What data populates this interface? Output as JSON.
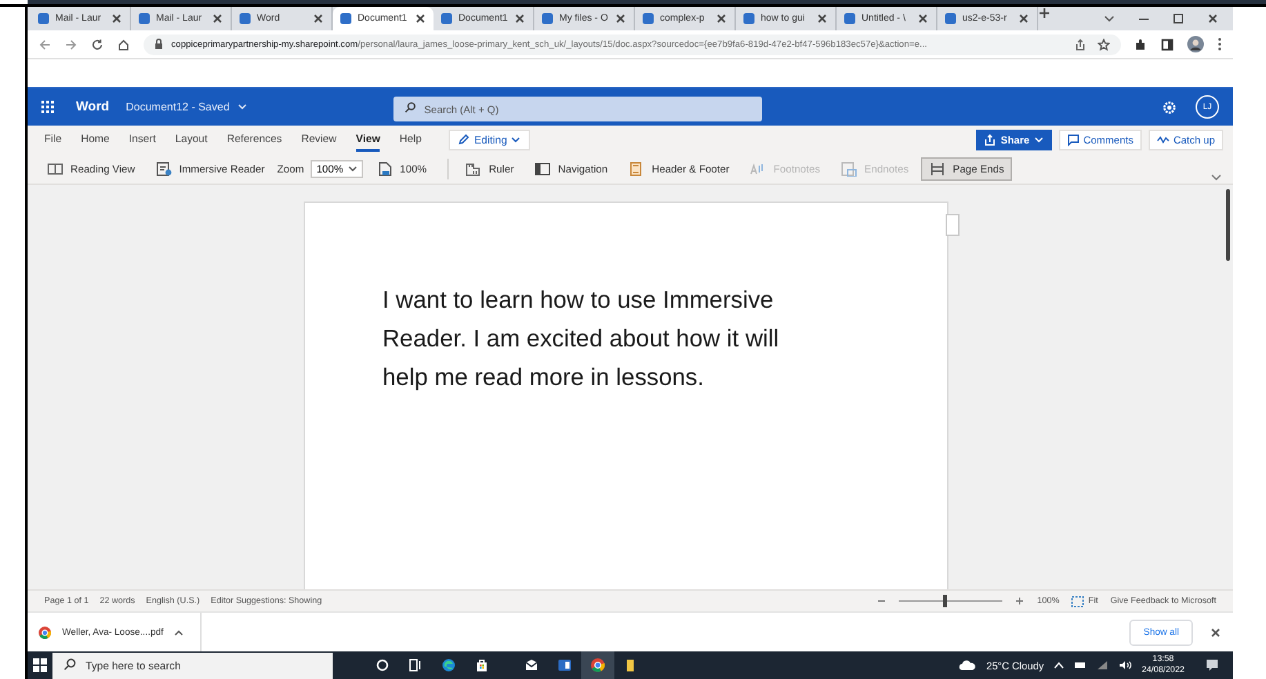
{
  "browser": {
    "tabs": [
      {
        "label": "Mail - Laur",
        "selected": false
      },
      {
        "label": "Mail - Laur",
        "selected": false
      },
      {
        "label": "Word",
        "selected": false
      },
      {
        "label": "Document1",
        "selected": true
      },
      {
        "label": "Document1",
        "selected": false
      },
      {
        "label": "My files - O",
        "selected": false
      },
      {
        "label": "complex-p",
        "selected": false
      },
      {
        "label": "how to gui",
        "selected": false
      },
      {
        "label": "Untitled - \\",
        "selected": false
      },
      {
        "label": "us2-e-53-r",
        "selected": false
      }
    ],
    "address": {
      "host": "coppiceprimarypartnership-my.sharepoint.com",
      "path": "/personal/laura_james_loose-primary_kent_sch_uk/_layouts/15/doc.aspx?sourcedoc={ee7b9fa6-819d-47e2-bf47-596b183ec57e}&action=e..."
    }
  },
  "word": {
    "app_name": "Word",
    "document_title": "Document12 - Saved",
    "search": {
      "placeholder": "Search (Alt + Q)"
    },
    "avatar": "LJ",
    "menu": [
      {
        "label": "File",
        "selected": false
      },
      {
        "label": "Home",
        "selected": false
      },
      {
        "label": "Insert",
        "selected": false
      },
      {
        "label": "Layout",
        "selected": false
      },
      {
        "label": "References",
        "selected": false
      },
      {
        "label": "Review",
        "selected": false
      },
      {
        "label": "View",
        "selected": true
      },
      {
        "label": "Help",
        "selected": false
      }
    ],
    "mode": "Editing",
    "actions": [
      {
        "label": "Share",
        "kind": "primary"
      },
      {
        "label": "Comments",
        "kind": "outline"
      },
      {
        "label": "Catch up",
        "kind": "outline"
      }
    ],
    "toolbar": [
      {
        "kind": "button",
        "label": "Reading View",
        "disabled": false,
        "selected": false
      },
      {
        "kind": "button",
        "label": "Immersive Reader",
        "disabled": false,
        "selected": false
      },
      {
        "kind": "zoom",
        "label": "Zoom",
        "value": "100%"
      },
      {
        "kind": "button",
        "label": "100%",
        "disabled": false,
        "selected": false
      },
      {
        "kind": "separator"
      },
      {
        "kind": "button",
        "label": "Ruler",
        "disabled": false,
        "selected": false
      },
      {
        "kind": "button",
        "label": "Navigation",
        "disabled": false,
        "selected": false
      },
      {
        "kind": "button",
        "label": "Header & Footer",
        "disabled": false,
        "selected": false
      },
      {
        "kind": "button",
        "label": "Footnotes",
        "disabled": true,
        "selected": false
      },
      {
        "kind": "button",
        "label": "Endnotes",
        "disabled": true,
        "selected": false
      },
      {
        "kind": "button",
        "label": "Page Ends",
        "disabled": false,
        "selected": true
      }
    ]
  },
  "document": {
    "text": "I want to learn how to use Immersive Reader. I am excited about how it will help me read more in lessons."
  },
  "status_bar": {
    "items": [
      "Page 1 of 1",
      "22 words",
      "English (U.S.)",
      "Editor Suggestions: Showing"
    ],
    "zoom": {
      "level": 0.45,
      "reading": "100%"
    },
    "fit": "Fit",
    "feedback": "Give Feedback to Microsoft"
  },
  "downloads": {
    "file": "Weller, Ava- Loose....pdf",
    "show_all": "Show all"
  },
  "taskbar": {
    "search": {
      "placeholder": "Type here to search"
    },
    "weather": "25°C  Cloudy",
    "time": "13:58",
    "date": "24/08/2022"
  }
}
